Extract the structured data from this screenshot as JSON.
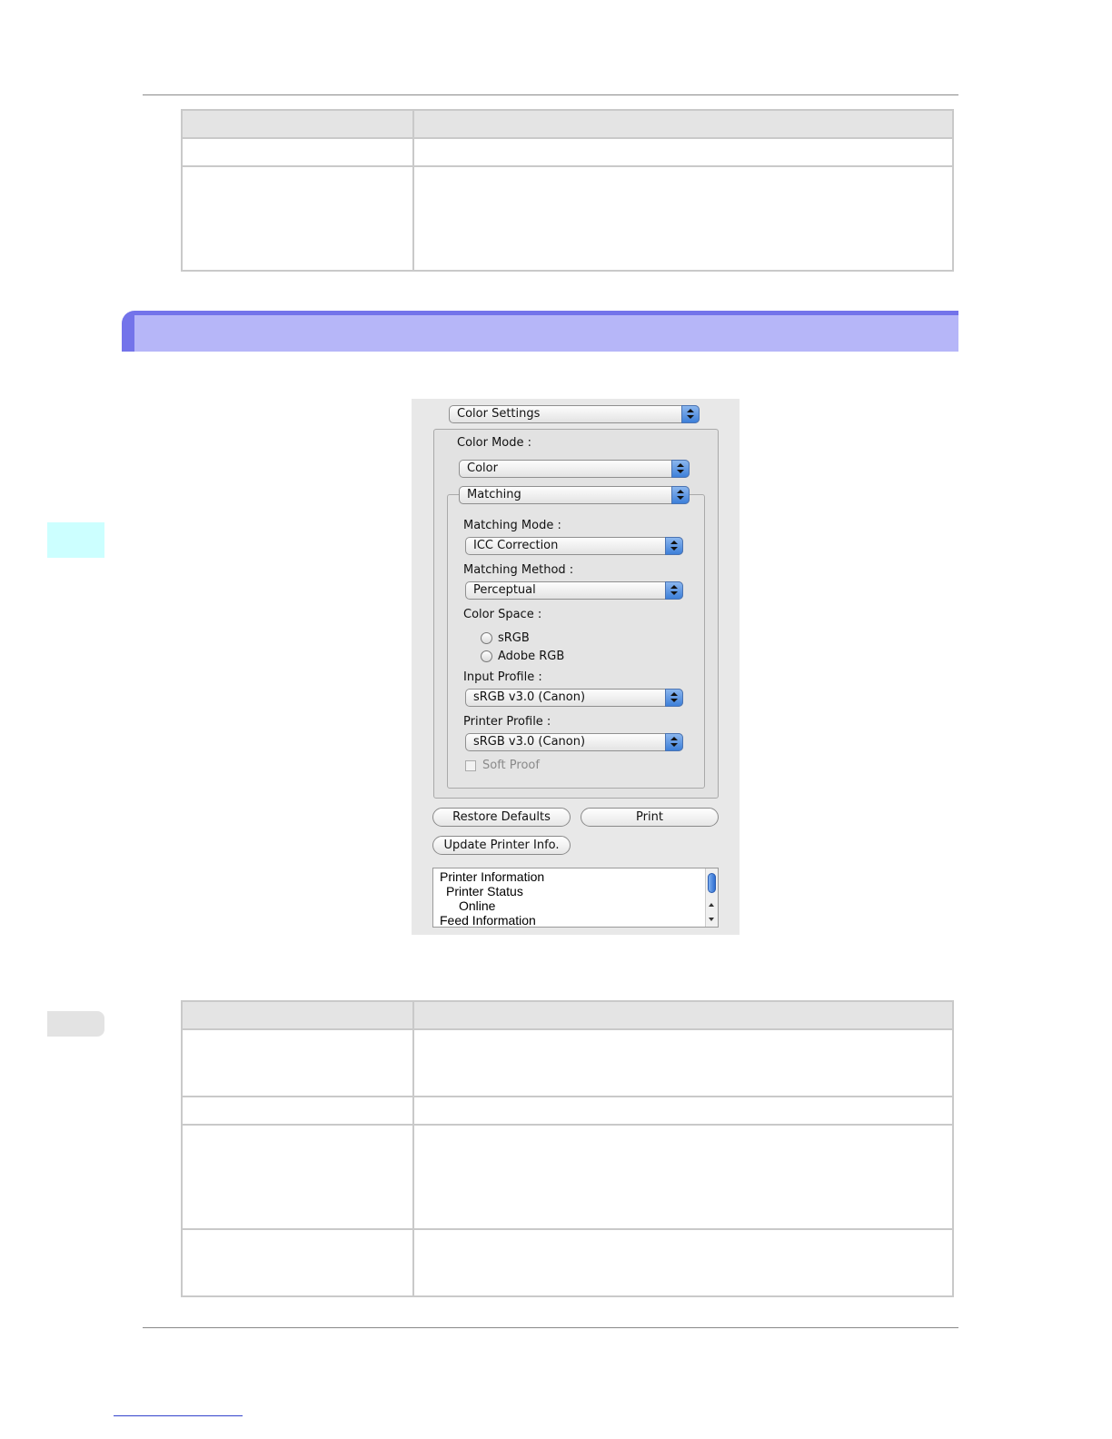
{
  "dialog": {
    "panel_menu": "Color Settings",
    "color_mode_label": "Color Mode :",
    "color_mode_value": "Color",
    "matching_menu": "Matching",
    "matching_mode_label": "Matching Mode :",
    "matching_mode_value": "ICC Correction",
    "matching_method_label": "Matching Method :",
    "matching_method_value": "Perceptual",
    "color_space_label": "Color Space :",
    "color_space_options": [
      "sRGB",
      "Adobe RGB"
    ],
    "input_profile_label": "Input Profile :",
    "input_profile_value": "sRGB v3.0 (Canon)",
    "printer_profile_label": "Printer Profile :",
    "printer_profile_value": "sRGB v3.0 (Canon)",
    "soft_proof_label": "Soft Proof",
    "restore_defaults_label": "Restore Defaults",
    "print_label": "Print",
    "update_printer_info_label": "Update Printer Info.",
    "printer_info_lines": [
      "Printer Information",
      "Printer Status",
      "Online",
      "Feed Information"
    ]
  },
  "colors": {
    "section_bar": "#b6b6f8",
    "section_bar_edge": "#7373ea",
    "side_tab": "#ccffff",
    "popup_arrow": "#3d7fd9"
  }
}
